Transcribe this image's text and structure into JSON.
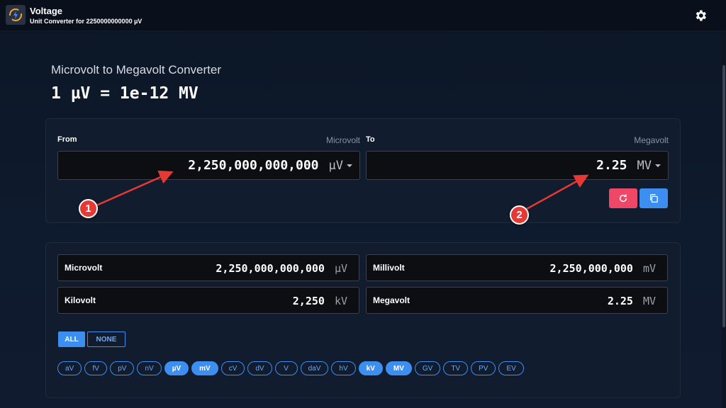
{
  "app": {
    "title": "Voltage",
    "subtitle": "Unit Converter for 2250000000000 µV"
  },
  "page": {
    "title": "Microvolt to Megavolt Converter",
    "equation": "1 µV = 1e-12 MV"
  },
  "converter": {
    "from_label": "From",
    "from_unit_name": "Microvolt",
    "from_value": "2,250,000,000,000",
    "from_unit": "µV",
    "to_label": "To",
    "to_unit_name": "Megavolt",
    "to_value": "2.25",
    "to_unit": "MV"
  },
  "results": [
    {
      "name": "Microvolt",
      "value": "2,250,000,000,000",
      "unit": "µV"
    },
    {
      "name": "Millivolt",
      "value": "2,250,000,000",
      "unit": "mV"
    },
    {
      "name": "Kilovolt",
      "value": "2,250",
      "unit": "kV"
    },
    {
      "name": "Megavolt",
      "value": "2.25",
      "unit": "MV"
    }
  ],
  "filters": {
    "all_label": "ALL",
    "none_label": "NONE",
    "units": [
      {
        "label": "aV",
        "active": false
      },
      {
        "label": "fV",
        "active": false
      },
      {
        "label": "pV",
        "active": false
      },
      {
        "label": "nV",
        "active": false
      },
      {
        "label": "µV",
        "active": true
      },
      {
        "label": "mV",
        "active": true
      },
      {
        "label": "cV",
        "active": false
      },
      {
        "label": "dV",
        "active": false
      },
      {
        "label": "V",
        "active": false
      },
      {
        "label": "daV",
        "active": false
      },
      {
        "label": "hV",
        "active": false
      },
      {
        "label": "kV",
        "active": true
      },
      {
        "label": "MV",
        "active": true
      },
      {
        "label": "GV",
        "active": false
      },
      {
        "label": "TV",
        "active": false
      },
      {
        "label": "PV",
        "active": false
      },
      {
        "label": "EV",
        "active": false
      }
    ]
  },
  "annotations": [
    "1",
    "2"
  ],
  "icons": {
    "settings": "gear-icon",
    "reset": "refresh-icon",
    "copy": "copy-icon",
    "logo": "voltage-logo-icon"
  },
  "colors": {
    "accent": "#3c8ef0",
    "reset": "#ee4866",
    "annotation": "#e53935"
  }
}
